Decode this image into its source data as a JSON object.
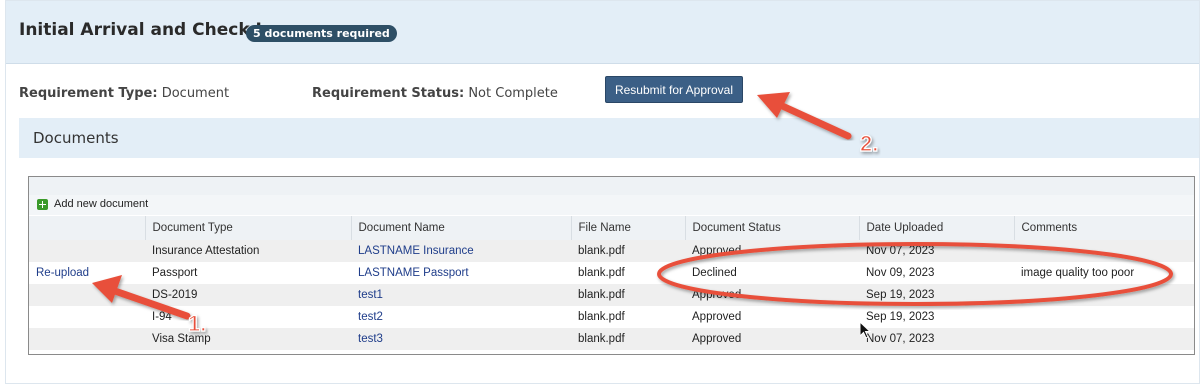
{
  "header": {
    "title": "Initial Arrival and Check In",
    "badge": "5 documents required"
  },
  "requirement": {
    "type_label": "Requirement Type:",
    "type_value": "Document",
    "status_label": "Requirement Status:",
    "status_value": "Not Complete"
  },
  "actions": {
    "resubmit_label": "Resubmit for Approval"
  },
  "documents_section": {
    "title": "Documents",
    "add_label": "Add new document"
  },
  "table": {
    "columns": [
      "",
      "Document Type",
      "Document Name",
      "File Name",
      "Document Status",
      "Date Uploaded",
      "Comments"
    ],
    "rows": [
      {
        "action": "",
        "type": "Insurance Attestation",
        "name": "LASTNAME Insurance",
        "file": "blank.pdf",
        "status": "Approved",
        "date": "Nov 07, 2023",
        "comments": ""
      },
      {
        "action": "Re-upload",
        "type": "Passport",
        "name": "LASTNAME Passport",
        "file": "blank.pdf",
        "status": "Declined",
        "date": "Nov 09, 2023",
        "comments": "image quality too poor"
      },
      {
        "action": "",
        "type": "DS-2019",
        "name": "test1",
        "file": "blank.pdf",
        "status": "Approved",
        "date": "Sep 19, 2023",
        "comments": ""
      },
      {
        "action": "",
        "type": "I-94",
        "name": "test2",
        "file": "blank.pdf",
        "status": "Approved",
        "date": "Sep 19, 2023",
        "comments": ""
      },
      {
        "action": "",
        "type": "Visa Stamp",
        "name": "test3",
        "file": "blank.pdf",
        "status": "Approved",
        "date": "Nov 07, 2023",
        "comments": ""
      }
    ]
  },
  "annotations": {
    "step1_label": "1.",
    "step2_label": "2."
  },
  "colors": {
    "accent": "#e8503a",
    "header_bg": "#e3eef7",
    "button_bg": "#3b5f86",
    "badge_bg": "#2e4f66",
    "link": "#1f3d8a"
  }
}
